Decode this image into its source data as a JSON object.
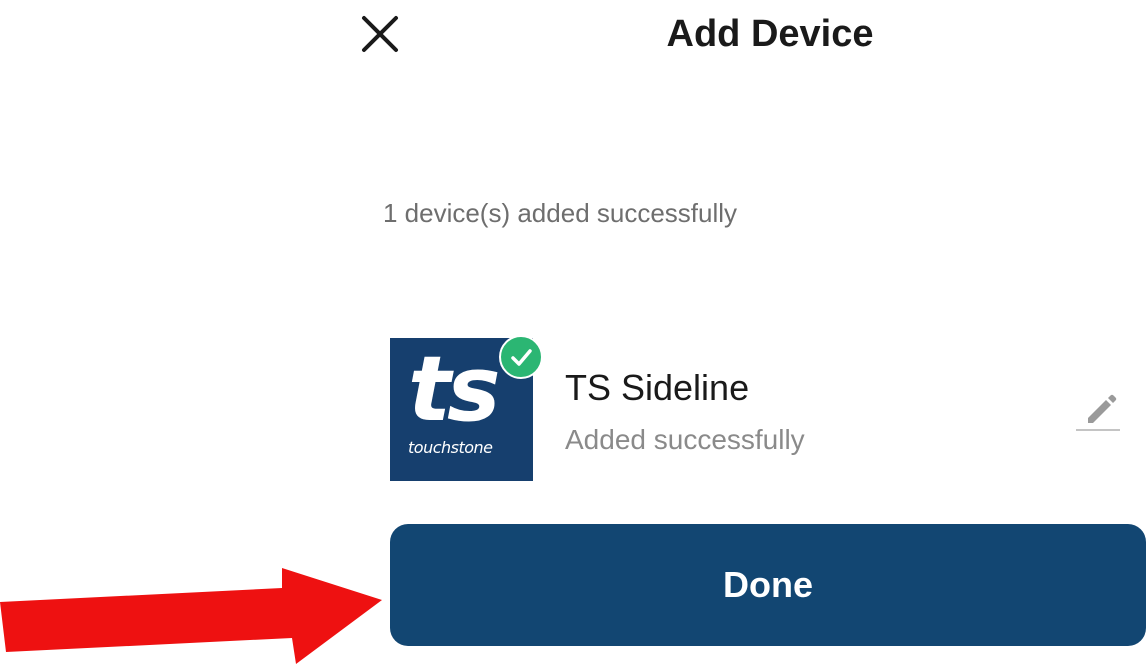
{
  "header": {
    "title": "Add Device",
    "close_icon": "close-icon"
  },
  "summary": {
    "text": "1 device(s) added successfully"
  },
  "device": {
    "logo_text": "ts",
    "logo_subtext": "touchstone",
    "name": "TS Sideline",
    "status": "Added successfully",
    "badge_icon": "check-icon",
    "edit_icon": "pencil-icon"
  },
  "actions": {
    "done_label": "Done"
  },
  "annotation": {
    "arrow_icon": "red-arrow-icon"
  },
  "colors": {
    "brand_blue": "#124672",
    "success_green": "#2bb673",
    "annotation_red": "#ee1111"
  }
}
